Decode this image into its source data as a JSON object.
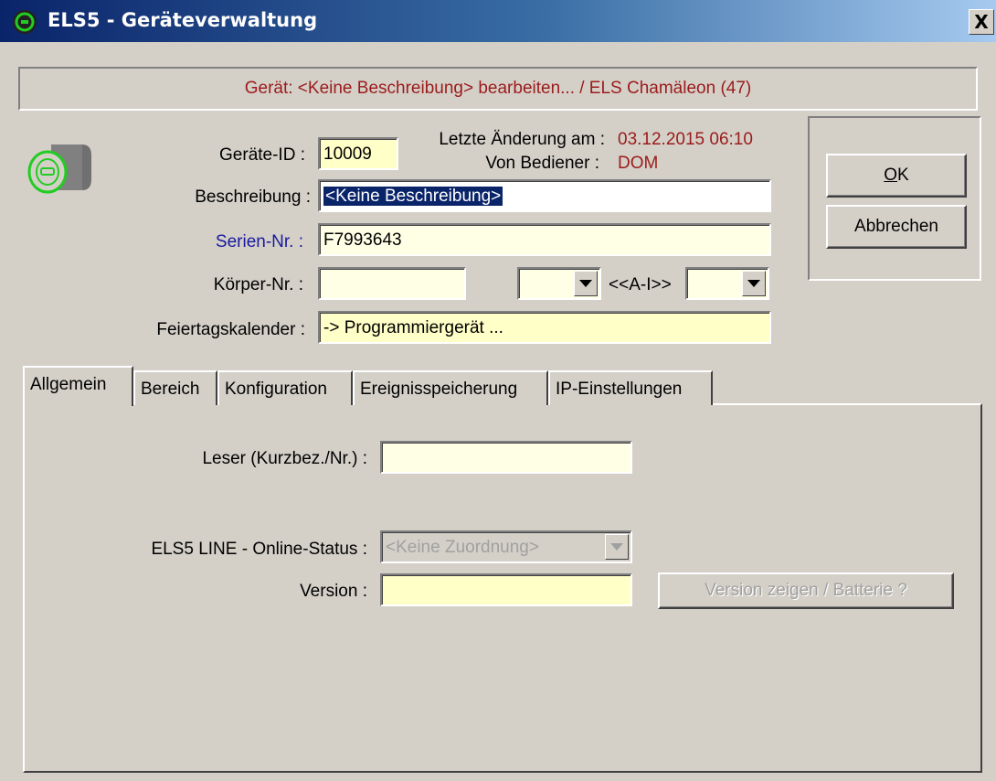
{
  "window": {
    "title": "ELS5 - Geräteverwaltung",
    "close_label": "X"
  },
  "banner": {
    "text": "Gerät: <Keine Beschreibung> bearbeiten... / ELS Chamäleon (47)"
  },
  "device": {
    "id_label": "Geräte-ID :",
    "id_value": "10009",
    "last_change_label": "Letzte Änderung am :",
    "last_change_value": "03.12.2015 06:10",
    "by_operator_label": "Von Bediener :",
    "by_operator_value": "DOM",
    "description_label": "Beschreibung :",
    "description_value": "<Keine Beschreibung>",
    "serial_label": "Serien-Nr. :",
    "serial_value": "F7993643",
    "body_label": "Körper-Nr. :",
    "body_value": "",
    "ai_label": "<<A-I>>",
    "holiday_label": "Feiertagskalender :",
    "holiday_value": "-> Programmiergerät ..."
  },
  "buttons": {
    "ok_label": "OK",
    "cancel_label": "Abbrechen"
  },
  "tabs": [
    {
      "label": "Allgemein",
      "active": true
    },
    {
      "label": "Bereich"
    },
    {
      "label": "Konfiguration"
    },
    {
      "label": "Ereignisspeicherung"
    },
    {
      "label": "IP-Einstellungen"
    }
  ],
  "general": {
    "reader_label": "Leser (Kurzbez./Nr.) :",
    "reader_value": "",
    "online_status_label": "ELS5 LINE - Online-Status :",
    "online_status_value": "<Keine Zuordnung>",
    "version_label": "Version :",
    "version_value": "",
    "version_button_label": "Version zeigen / Batterie ?"
  },
  "colors": {
    "accent_red": "#9b1b1b",
    "serial_blue": "#1a1a9e",
    "title_blue": "#0a246a",
    "icon_green": "#22cc22"
  }
}
